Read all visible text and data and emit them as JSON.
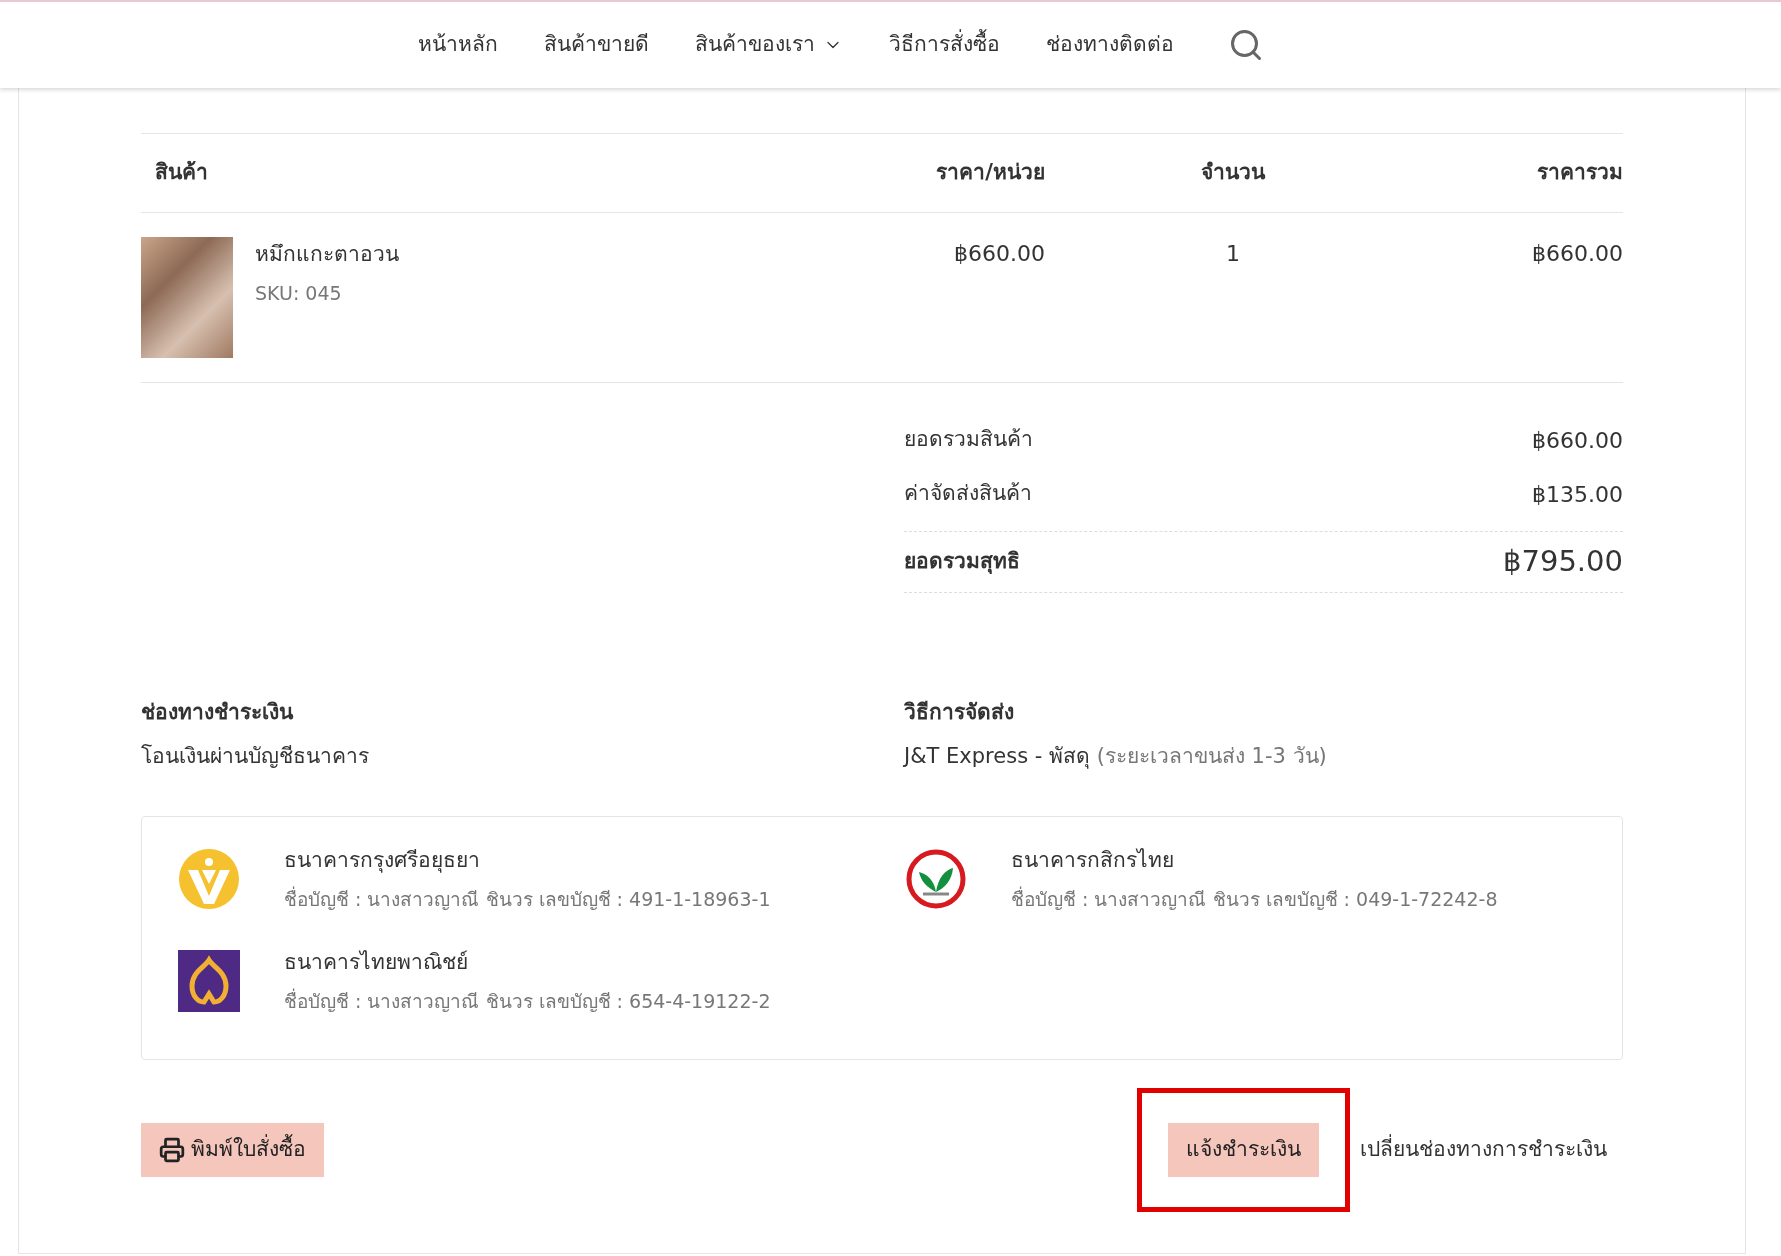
{
  "nav": {
    "items": [
      {
        "label": "หน้าหลัก",
        "dropdown": false
      },
      {
        "label": "สินค้าขายดี",
        "dropdown": false
      },
      {
        "label": "สินค้าของเรา",
        "dropdown": true
      },
      {
        "label": "วิธีการสั่งซื้อ",
        "dropdown": false
      },
      {
        "label": "ช่องทางติดต่อ",
        "dropdown": false
      }
    ]
  },
  "table": {
    "columns": [
      "สินค้า",
      "ราคา/หน่วย",
      "จำนวน",
      "ราคารวม"
    ],
    "rows": [
      {
        "name": "หมึกแกะตาอวน",
        "sku": "SKU: 045",
        "price": "฿660.00",
        "qty": "1",
        "total": "฿660.00"
      }
    ]
  },
  "totals": [
    {
      "label": "ยอดรวมสินค้า",
      "value": "฿660.00",
      "kind": "line"
    },
    {
      "label": "ค่าจัดส่งสินค้า",
      "value": "฿135.00",
      "kind": "line"
    },
    {
      "label": "ยอดรวมสุทธิ",
      "value": "฿795.00",
      "kind": "grand"
    }
  ],
  "payment": {
    "heading": "ช่องทางชำระเงิน",
    "value": "โอนเงินผ่านบัญชีธนาคาร"
  },
  "shipping": {
    "heading": "วิธีการจัดส่ง",
    "value": "J&T Express - พัสดุ",
    "note": "(ระยะเวลาขนส่ง 1-3 วัน)"
  },
  "banks": [
    {
      "kind": "krungsri",
      "name": "ธนาคารกรุงศรีอยุธยา",
      "account": "ชื่อบัญชี : นางสาวญาณี ชินวร เลขบัญชี : 491-1-18963-1"
    },
    {
      "kind": "kbank",
      "name": "ธนาคารกสิกรไทย",
      "account": "ชื่อบัญชี : นางสาวญาณี ชินวร เลขบัญชี : 049-1-72242-8"
    },
    {
      "kind": "scb",
      "name": "ธนาคารไทยพาณิชย์",
      "account": "ชื่อบัญชี : นางสาวญาณี ชินวร เลขบัญชี : 654-4-19122-2"
    }
  ],
  "actions": {
    "print": "พิมพ์ใบสั่งซื้อ",
    "notify": {
      "label": "แจ้งชำระเงิน",
      "highlighted": true
    },
    "change": "เปลี่ยนช่องทางการชำระเงิน"
  }
}
